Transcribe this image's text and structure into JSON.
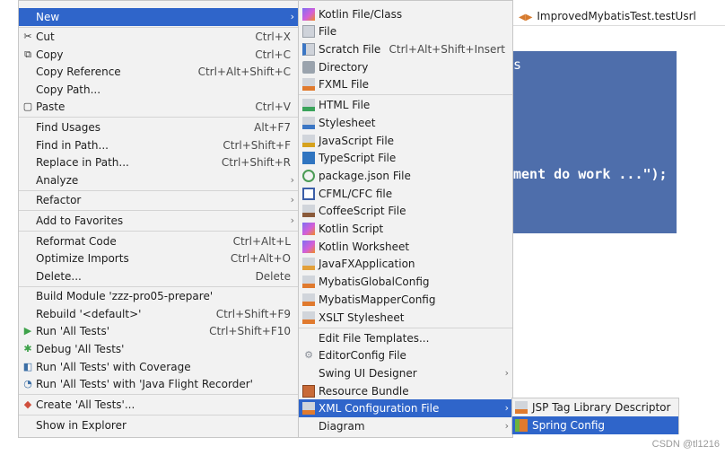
{
  "editor": {
    "tab_title": "ImprovedMybatisTest.testUsrl",
    "stray_char": "s",
    "code_line": "ment do work ...\");"
  },
  "watermark": "CSDN @tl1216",
  "main_menu": [
    {
      "label": "New",
      "arrow": "›"
    },
    {
      "label": "Cut",
      "shortcut": "Ctrl+X",
      "icon": "✂"
    },
    {
      "label": "Copy",
      "shortcut": "Ctrl+C",
      "icon": "⧉"
    },
    {
      "label": "Copy Reference",
      "shortcut": "Ctrl+Alt+Shift+C"
    },
    {
      "label": "Copy Path..."
    },
    {
      "label": "Paste",
      "shortcut": "Ctrl+V",
      "icon": "▢"
    },
    {
      "label": "Find Usages",
      "shortcut": "Alt+F7"
    },
    {
      "label": "Find in Path...",
      "shortcut": "Ctrl+Shift+F"
    },
    {
      "label": "Replace in Path...",
      "shortcut": "Ctrl+Shift+R"
    },
    {
      "label": "Analyze",
      "arrow": "›"
    },
    {
      "label": "Refactor",
      "arrow": "›"
    },
    {
      "label": "Add to Favorites",
      "arrow": "›"
    },
    {
      "label": "Reformat Code",
      "shortcut": "Ctrl+Alt+L"
    },
    {
      "label": "Optimize Imports",
      "shortcut": "Ctrl+Alt+O"
    },
    {
      "label": "Delete...",
      "shortcut": "Delete"
    },
    {
      "label": "Build Module 'zzz-pro05-prepare'"
    },
    {
      "label": "Rebuild '<default>'",
      "shortcut": "Ctrl+Shift+F9"
    },
    {
      "label": "Run 'All Tests'",
      "shortcut": "Ctrl+Shift+F10",
      "icon": "▶"
    },
    {
      "label": "Debug 'All Tests'",
      "icon": "✱"
    },
    {
      "label": "Run 'All Tests' with Coverage",
      "icon": "◧"
    },
    {
      "label": "Run 'All Tests' with 'Java Flight Recorder'",
      "icon": "◔"
    },
    {
      "label": "Create 'All Tests'...",
      "icon": "◆"
    },
    {
      "label": "Show in Explorer"
    }
  ],
  "new_menu": [
    {
      "label": "Kotlin File/Class",
      "icon": "kotlin-icon"
    },
    {
      "label": "File",
      "icon": "file-icon"
    },
    {
      "label": "Scratch File",
      "shortcut": "Ctrl+Alt+Shift+Insert",
      "icon": "scratch-file-icon"
    },
    {
      "label": "Directory",
      "icon": "folder-icon"
    },
    {
      "label": "FXML File",
      "icon": "fxml-icon"
    },
    {
      "label": "HTML File",
      "icon": "html-icon"
    },
    {
      "label": "Stylesheet",
      "icon": "css-icon"
    },
    {
      "label": "JavaScript File",
      "icon": "javascript-icon"
    },
    {
      "label": "TypeScript File",
      "icon": "typescript-icon"
    },
    {
      "label": "package.json File",
      "icon": "package-json-icon"
    },
    {
      "label": "CFML/CFC file",
      "icon": "cfml-icon"
    },
    {
      "label": "CoffeeScript File",
      "icon": "coffeescript-icon"
    },
    {
      "label": "Kotlin Script",
      "icon": "kotlin-script-icon"
    },
    {
      "label": "Kotlin Worksheet",
      "icon": "kotlin-worksheet-icon"
    },
    {
      "label": "JavaFXApplication",
      "icon": "javafx-icon"
    },
    {
      "label": "MybatisGlobalConfig",
      "icon": "mybatis-global-config-icon"
    },
    {
      "label": "MybatisMapperConfig",
      "icon": "mybatis-mapper-config-icon"
    },
    {
      "label": "XSLT Stylesheet",
      "icon": "xslt-icon"
    },
    {
      "label": "Edit File Templates..."
    },
    {
      "label": "EditorConfig File",
      "icon": "gear-icon"
    },
    {
      "label": "Swing UI Designer",
      "arrow": "›"
    },
    {
      "label": "Resource Bundle",
      "icon": "resource-bundle-icon"
    },
    {
      "label": "XML Configuration File",
      "arrow": "›",
      "icon": "xml-config-icon"
    },
    {
      "label": "Diagram",
      "arrow": "›"
    }
  ],
  "xml_menu": [
    {
      "label": "JSP Tag Library Descriptor",
      "icon": "jsp-tld-icon"
    },
    {
      "label": "Spring Config",
      "icon": "spring-config-icon"
    }
  ]
}
